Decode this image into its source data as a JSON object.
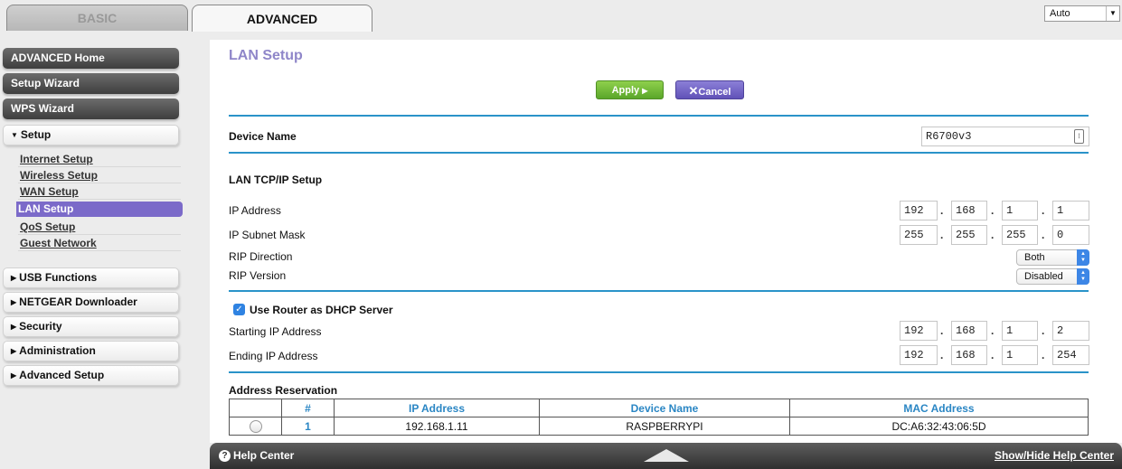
{
  "tabs": {
    "basic": "BASIC",
    "advanced": "ADVANCED"
  },
  "language": {
    "selected": "Auto"
  },
  "sidebar": {
    "top_items": [
      "ADVANCED Home",
      "Setup Wizard",
      "WPS Wizard"
    ],
    "setup": {
      "label": "Setup",
      "items": [
        "Internet Setup",
        "Wireless Setup",
        "WAN Setup",
        "LAN Setup",
        "QoS Setup",
        "Guest Network"
      ]
    },
    "collapsed_items": [
      "USB Functions",
      "NETGEAR Downloader",
      "Security",
      "Administration",
      "Advanced Setup"
    ]
  },
  "page": {
    "title": "LAN Setup",
    "apply_label": "Apply",
    "cancel_label": "Cancel",
    "device_name_label": "Device Name",
    "device_name_value": "R6700v3",
    "lan_tcpip_label": "LAN TCP/IP Setup",
    "ip_address_label": "IP Address",
    "ip_address": [
      "192",
      "168",
      "1",
      "1"
    ],
    "subnet_mask_label": "IP Subnet Mask",
    "subnet_mask": [
      "255",
      "255",
      "255",
      "0"
    ],
    "rip_direction_label": "RIP Direction",
    "rip_direction_value": "Both",
    "rip_version_label": "RIP Version",
    "rip_version_value": "Disabled",
    "dhcp_label": "Use Router as DHCP Server",
    "dhcp_checked": true,
    "start_ip_label": "Starting IP Address",
    "start_ip": [
      "192",
      "168",
      "1",
      "2"
    ],
    "end_ip_label": "Ending IP Address",
    "end_ip": [
      "192",
      "168",
      "1",
      "254"
    ],
    "reservation_label": "Address Reservation",
    "reservation_headers": [
      "#",
      "IP Address",
      "Device Name",
      "MAC Address"
    ],
    "reservation_rows": [
      {
        "num": "1",
        "ip": "192.168.1.11",
        "device": "RASPBERRYPI",
        "mac": "DC:A6:32:43:06:5D"
      }
    ]
  },
  "help": {
    "left": "Help Center",
    "right": "Show/Hide Help Center"
  },
  "colors": {
    "accent_purple": "#7b6ac9",
    "divider_blue": "#2a93c9",
    "apply_green": "#5aa62a"
  }
}
